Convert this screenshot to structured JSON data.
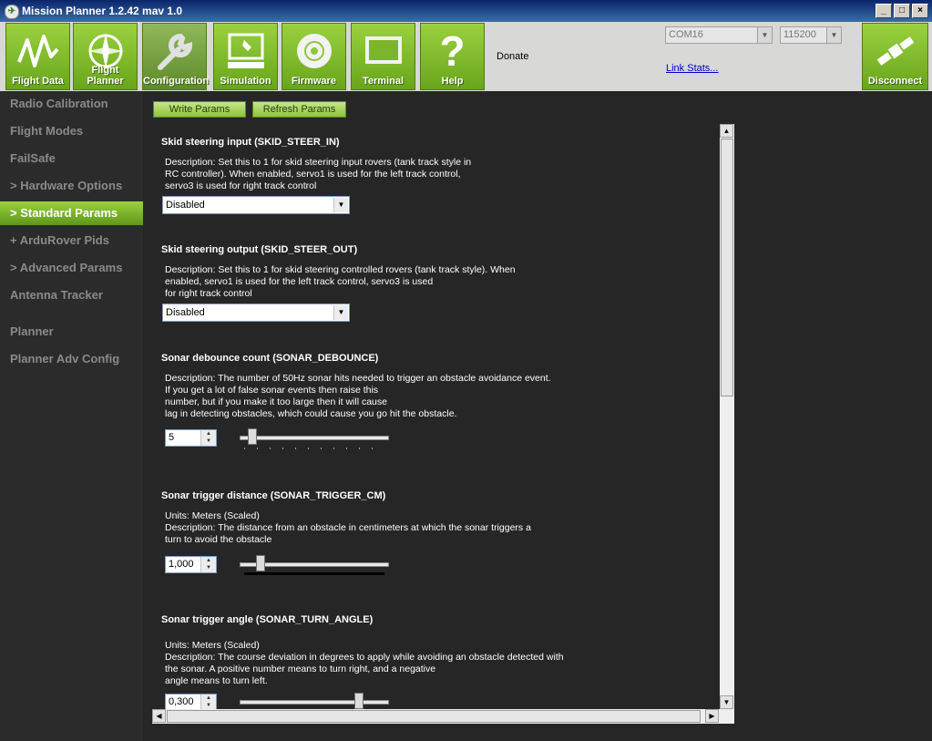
{
  "window": {
    "title": "Mission Planner 1.2.42 mav 1.0",
    "controls": [
      "_",
      "□",
      "×"
    ]
  },
  "toolbar": {
    "buttons": [
      {
        "label": "Flight Data",
        "icon": "flight-data-icon"
      },
      {
        "label": "Flight Planner",
        "icon": "flight-planner-icon"
      },
      {
        "label": "Configuration",
        "icon": "wrench-icon"
      },
      {
        "label": "Simulation",
        "icon": "simulation-icon"
      },
      {
        "label": "Firmware",
        "icon": "firmware-disc-icon"
      },
      {
        "label": "Terminal",
        "icon": "terminal-icon"
      },
      {
        "label": "Help",
        "icon": "help-question-icon"
      }
    ],
    "donate": "Donate",
    "port": "COM16",
    "baud": "115200",
    "link_stats": "Link Stats...",
    "disconnect": "Disconnect"
  },
  "sidebar": {
    "items": [
      {
        "label": "Radio Calibration"
      },
      {
        "label": "Flight Modes"
      },
      {
        "label": "FailSafe"
      },
      {
        "label": "> Hardware Options"
      },
      {
        "label": "> Standard Params",
        "active": true
      },
      {
        "label": "+ ArduRover Pids"
      },
      {
        "label": "> Advanced Params"
      },
      {
        "label": "Antenna Tracker"
      },
      {
        "label": "Planner"
      },
      {
        "label": "Planner Adv Config"
      }
    ]
  },
  "actions": {
    "write": "Write Params",
    "refresh": "Refresh Params"
  },
  "params": [
    {
      "title": "Skid steering input (SKID_STEER_IN)",
      "desc": "Description: Set this to 1 for skid steering input rovers (tank track style in\nRC controller). When enabled, servo1 is used for the left track control,\nservo3 is used for right track control",
      "select": "Disabled"
    },
    {
      "title": "Skid steering output (SKID_STEER_OUT)",
      "desc": "Description: Set this to 1 for skid steering controlled rovers (tank track style). When\nenabled, servo1 is used for the left track control, servo3 is used\nfor right track control",
      "select": "Disabled"
    },
    {
      "title": "Sonar debounce count (SONAR_DEBOUNCE)",
      "desc": "Description: The number of 50Hz sonar hits needed to trigger an obstacle avoidance event.\nIf you get a lot of false sonar events then raise this\nnumber, but if you make it too large then it will cause\nlag in detecting obstacles, which could cause you go hit the obstacle.",
      "value": "5",
      "slider": 0.06
    },
    {
      "title": "Sonar trigger distance (SONAR_TRIGGER_CM)",
      "desc": "Units: Meters (Scaled)\nDescription: The distance from an obstacle in centimeters at which the sonar triggers a\nturn to avoid the obstacle",
      "value": "1,000",
      "slider": 0.12
    },
    {
      "title": "Sonar trigger angle (SONAR_TURN_ANGLE)",
      "desc": "Units: Meters (Scaled)\nDescription: The course deviation in degrees to apply while avoiding an obstacle detected with\nthe sonar. A positive number means to turn right, and a negative\nangle means to turn left.",
      "value": "0,300",
      "slider": 0.82
    }
  ],
  "colors": {
    "accent": "#8fc63a",
    "background": "#262626",
    "sidebar_text": "#8a8a8a"
  }
}
